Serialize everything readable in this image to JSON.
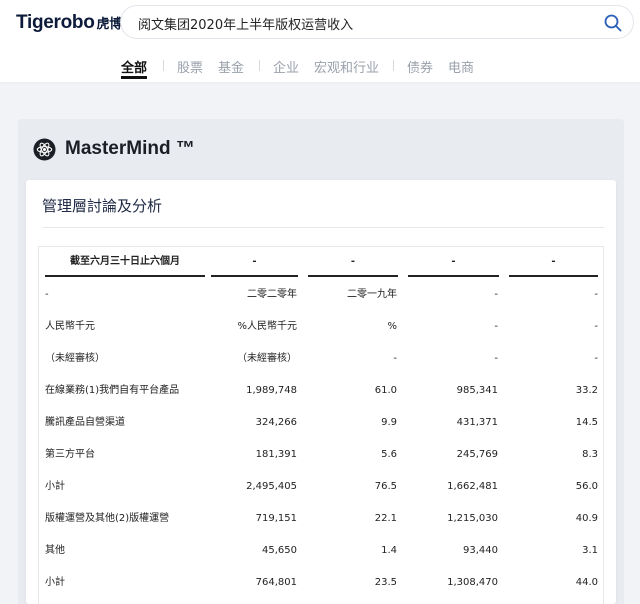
{
  "brand": {
    "name": "Tigerobo",
    "name_cn": "虎博"
  },
  "search": {
    "query": "阅文集团2020年上半年版权运营收入"
  },
  "tabs": [
    "全部",
    "股票",
    "基金",
    "企业",
    "宏观和行业",
    "债券",
    "电商"
  ],
  "mastermind": {
    "title": "MasterMind ™"
  },
  "section": {
    "title": "管理層討論及分析"
  },
  "table": {
    "headers": [
      "截至六月三十日止六個月",
      "-",
      "-",
      "-",
      "-"
    ],
    "rows": [
      [
        "-",
        "二零二零年",
        "二零一九年",
        "-",
        "-"
      ],
      [
        "人民幣千元",
        "%人民幣千元",
        "%",
        "-",
        "-"
      ],
      [
        "（未經審核）",
        "（未經審核）",
        "-",
        "-",
        "-"
      ],
      [
        "在線業務(1)我們自有平台產品",
        "1,989,748",
        "61.0",
        "985,341",
        "33.2"
      ],
      [
        "騰訊產品自營渠道",
        "324,266",
        "9.9",
        "431,371",
        "14.5"
      ],
      [
        "第三方平台",
        "181,391",
        "5.6",
        "245,769",
        "8.3"
      ],
      [
        "小計",
        "2,495,405",
        "76.5",
        "1,662,481",
        "56.0"
      ],
      [
        "版權運營及其他(2)版權運營",
        "719,151",
        "22.1",
        "1,215,030",
        "40.9"
      ],
      [
        "其他",
        "45,650",
        "1.4",
        "93,440",
        "3.1"
      ],
      [
        "小計",
        "764,801",
        "23.5",
        "1,308,470",
        "44.0"
      ]
    ]
  }
}
